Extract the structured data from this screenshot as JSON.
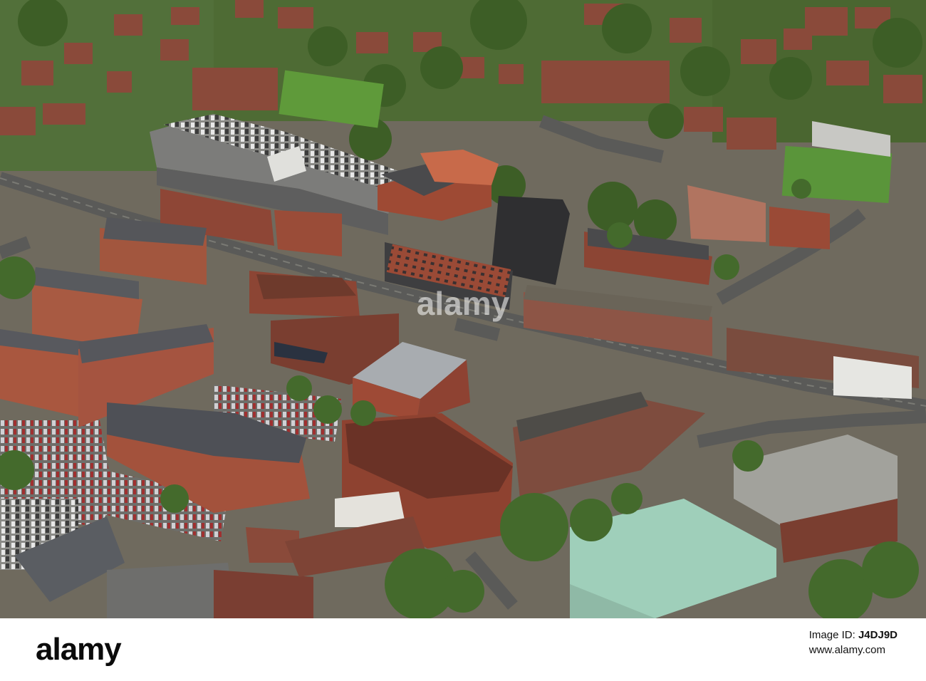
{
  "watermark": {
    "text": "alamy"
  },
  "footer": {
    "brand": "alamy",
    "image_id_label": "Image ID:",
    "image_id": "J4DJ9D",
    "url": "www.alamy.com"
  }
}
